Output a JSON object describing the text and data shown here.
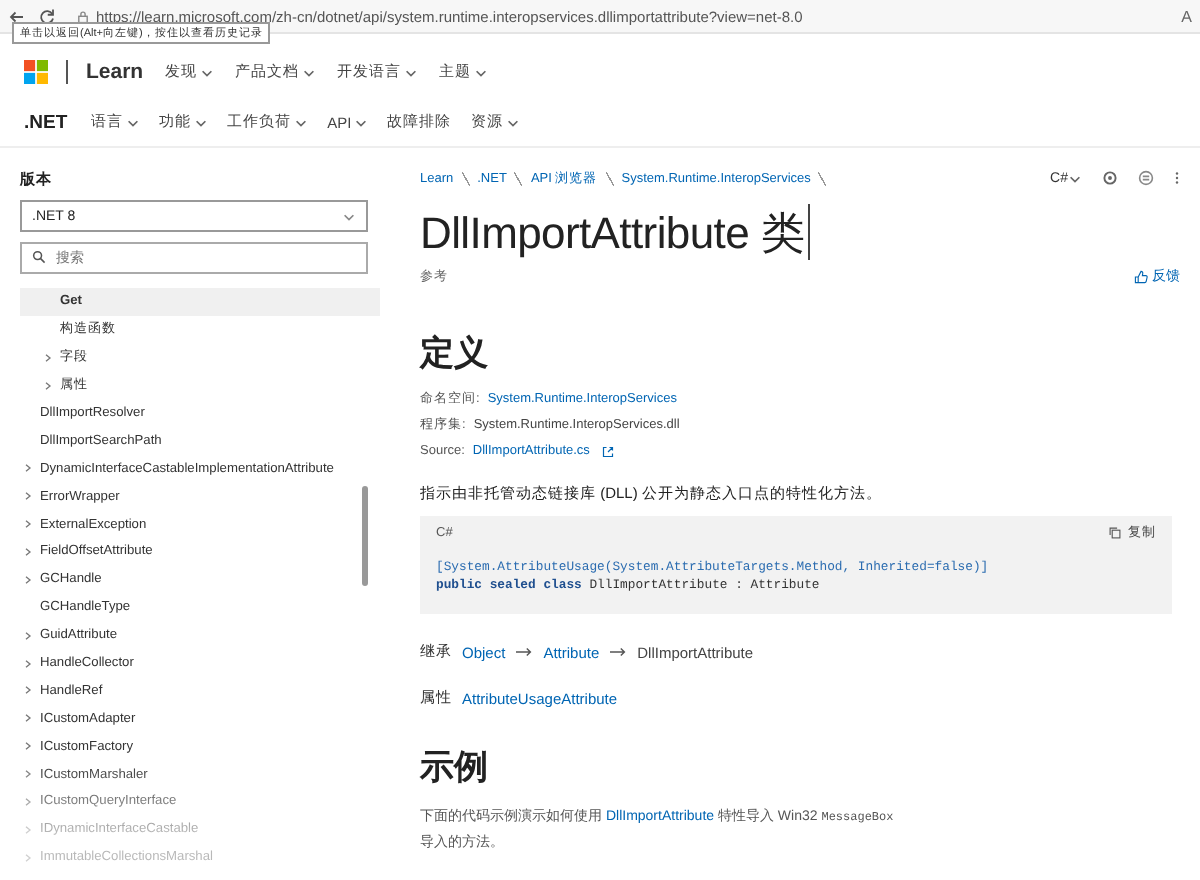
{
  "browser": {
    "url": "https://learn.microsoft.com/zh-cn/dotnet/api/system.runtime.interopservices.dllimportattribute?view=net-8.0",
    "reader_label": "A",
    "tooltip": "单击以返回(Alt+向左键)，按住以查看历史记录"
  },
  "header": {
    "brand": "Learn",
    "menu": [
      {
        "label": "发现",
        "dropdown": true
      },
      {
        "label": "产品文档",
        "dropdown": true
      },
      {
        "label": "开发语言",
        "dropdown": true
      },
      {
        "label": "主题",
        "dropdown": true
      }
    ]
  },
  "subnav": {
    "title": ".NET",
    "menu": [
      {
        "label": "语言",
        "dropdown": true
      },
      {
        "label": "功能",
        "dropdown": true
      },
      {
        "label": "工作负荷",
        "dropdown": true
      },
      {
        "label": "API",
        "dropdown": true
      },
      {
        "label": "故障排除",
        "dropdown": false
      },
      {
        "label": "资源",
        "dropdown": true
      }
    ]
  },
  "sidebar": {
    "version_label": "版本",
    "version": ".NET 8",
    "search": {
      "placeholder": "搜索"
    },
    "tree": [
      {
        "children": [
          {
            "label": "Get",
            "selected": true,
            "collapsible": false
          },
          {
            "label": "构造函数",
            "selected": false,
            "collapsible": false
          },
          {
            "label": "字段",
            "selected": false,
            "collapsible": true
          },
          {
            "label": "属性",
            "selected": false,
            "collapsible": true
          }
        ]
      },
      {
        "label": "DllImportResolver",
        "selected": false,
        "collapsible": false
      },
      {
        "label": "DllImportSearchPath",
        "selected": false,
        "collapsible": false
      },
      {
        "label": "DynamicInterfaceCastableImplementationAttribute",
        "selected": false,
        "collapsible": true
      },
      {
        "label": "ErrorWrapper",
        "selected": false,
        "collapsible": true
      },
      {
        "label": "ExternalException",
        "selected": false,
        "collapsible": true
      },
      {
        "label": "FieldOffsetAttribute",
        "selected": false,
        "collapsible": true
      },
      {
        "label": "GCHandle",
        "selected": false,
        "collapsible": true
      },
      {
        "label": "GCHandleType",
        "selected": false,
        "collapsible": false
      },
      {
        "label": "GuidAttribute",
        "selected": false,
        "collapsible": true
      },
      {
        "label": "HandleCollector",
        "selected": false,
        "collapsible": true
      },
      {
        "label": "HandleRef",
        "selected": false,
        "collapsible": true
      },
      {
        "label": "ICustomAdapter",
        "selected": false,
        "collapsible": true
      },
      {
        "label": "ICustomFactory",
        "selected": false,
        "collapsible": true
      },
      {
        "label": "ICustomMarshaler",
        "selected": false,
        "collapsible": true
      },
      {
        "label": "ICustomQueryInterface",
        "selected": false,
        "collapsible": true
      },
      {
        "label": "IDynamicInterfaceCastable",
        "selected": false,
        "collapsible": true
      },
      {
        "label": "ImmutableCollectionsMarshal",
        "selected": false,
        "collapsible": true
      }
    ]
  },
  "content": {
    "breadcrumb": [
      "Learn",
      ".NET",
      "API 浏览器",
      "System.Runtime.InteropServices"
    ],
    "language": "C#",
    "title": "DllImportAttribute 类",
    "subtitle": "参考",
    "feedback": "反馈",
    "definition_heading": "定义",
    "meta": [
      {
        "label": "命名空间:",
        "value": "System.Runtime.InteropServices",
        "link": true,
        "external": false
      },
      {
        "label": "程序集:",
        "value": "System.Runtime.InteropServices.dll",
        "link": false,
        "external": false
      },
      {
        "label": "Source:",
        "value": "DllImportAttribute.cs",
        "link": true,
        "external": true
      }
    ],
    "description": "指示由非托管动态链接库 (DLL) 公开为静态入口点的特性化方法。",
    "code": {
      "language": "C#",
      "copy_label": "复制",
      "lines": [
        [
          {
            "text": "[System.AttributeUsage(System.AttributeTargets.Method, Inherited=false)]",
            "kind": "type"
          }
        ],
        [
          {
            "text": "public sealed class ",
            "kind": "keyword"
          },
          {
            "text": "DllImportAttribute : Attribute",
            "kind": "plain"
          }
        ]
      ]
    },
    "inheritance": {
      "label": "继承",
      "chain": [
        {
          "text": "Object",
          "link": true
        },
        {
          "text": "Attribute",
          "link": true
        },
        {
          "text": "DllImportAttribute",
          "link": false
        }
      ]
    },
    "attributes": {
      "label": "属性",
      "value": "AttributeUsageAttribute"
    },
    "example_heading": "示例",
    "example_lines": [
      [
        {
          "text": "下面的代码示例演示如何使用 ",
          "link": false
        },
        {
          "text": "DllImportAttribute",
          "link": true
        },
        {
          "text": " 特性导入 Win32 ",
          "link": false
        },
        {
          "text": "MessageBox",
          "link": false,
          "code": true
        }
      ],
      [
        {
          "text": "导入的方法。",
          "link": false
        }
      ]
    ]
  }
}
